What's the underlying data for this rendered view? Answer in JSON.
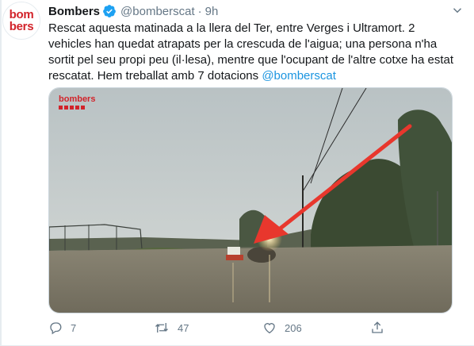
{
  "colors": {
    "brand_red": "#d2232a",
    "link_blue": "#1b95e0",
    "verified_blue": "#1da1f2",
    "secondary_text": "#657786"
  },
  "author": {
    "avatar_line1": "bom",
    "avatar_line2": "bers",
    "name": "Bombers",
    "verified_icon": "verified-badge-icon",
    "handle": "@bomberscat",
    "separator": "·",
    "time": "9h"
  },
  "tweet": {
    "text": "Rescat aquesta matinada a la llera del Ter, entre Verges i Ultramort. 2 vehicles han quedat atrapats per la crescuda de l'aigua; una persona n'ha sortit pel seu propi peu (il·lesa), mentre que l'ocupant de l'altre cotxe ha estat rescatat. Hem treballat amb 7 dotacions",
    "mention": "@bomberscat"
  },
  "media": {
    "watermark": "bombers",
    "icon": "flooded-road-photo"
  },
  "actions": {
    "reply": {
      "icon": "reply-icon",
      "count": "7"
    },
    "retweet": {
      "icon": "retweet-icon",
      "count": "47"
    },
    "like": {
      "icon": "heart-icon",
      "count": "206"
    },
    "share": {
      "icon": "share-icon"
    }
  }
}
